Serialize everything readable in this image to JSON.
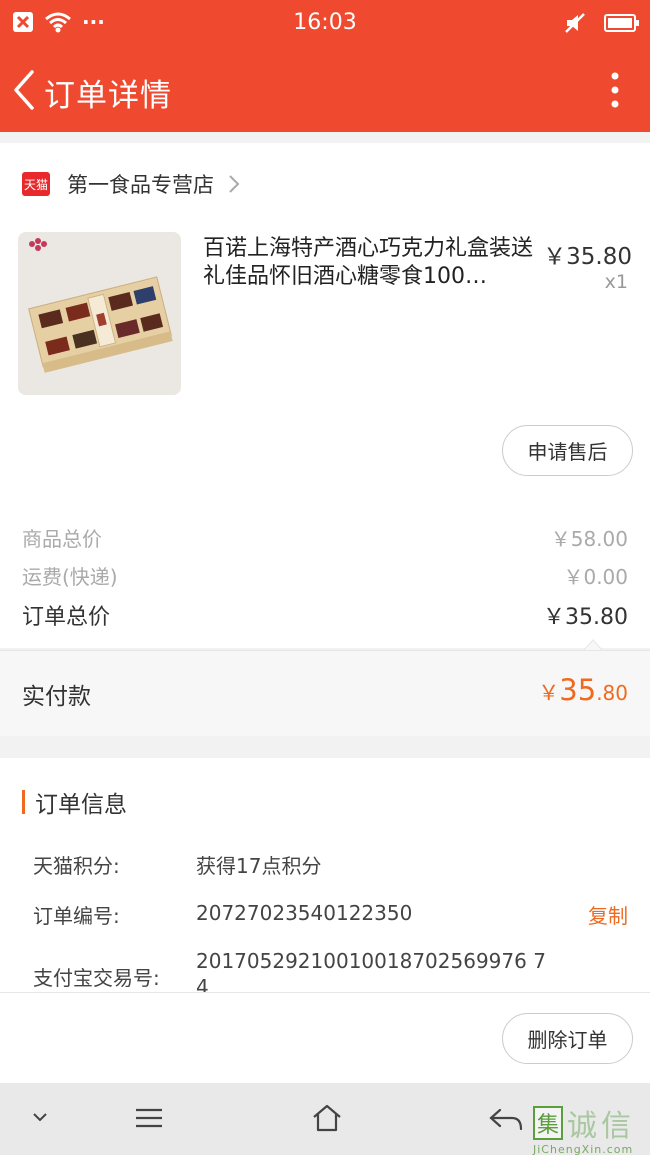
{
  "status_bar": {
    "time": "16:03",
    "dots": "···"
  },
  "header": {
    "title": "订单详情"
  },
  "store": {
    "badge": "天猫",
    "name": "第一食品专营店"
  },
  "product": {
    "title": "百诺上海特产酒心巧克力礼盒装送礼佳品怀旧酒心糖零食100…",
    "price": "￥35.80",
    "quantity": "x1",
    "aftersale_label": "申请售后"
  },
  "summary": {
    "goods_total_label": "商品总价",
    "goods_total_value": "￥58.00",
    "shipping_label": "运费(快递)",
    "shipping_value": "￥0.00",
    "order_total_label": "订单总价",
    "order_total_value": "￥35.80"
  },
  "payment": {
    "label": "实付款",
    "currency": "￥",
    "integer": "35",
    "decimal": ".80"
  },
  "order_info": {
    "title": "订单信息",
    "points_label": "天猫积分:",
    "points_value": "获得17点积分",
    "order_no_label": "订单编号:",
    "order_no_value": "20727023540122350",
    "copy_label": "复制",
    "alipay_label": "支付宝交易号:",
    "alipay_value": "20170529210010018702569976 74"
  },
  "footer": {
    "delete_label": "删除订单"
  },
  "watermark": {
    "c1": "集",
    "c2": "诚",
    "c3": "信",
    "url": "JiChengXin.com"
  },
  "colors": {
    "brand_red": "#ef4a2f",
    "accent_orange": "#ef6a1f",
    "tmall_red": "#e8282b"
  }
}
